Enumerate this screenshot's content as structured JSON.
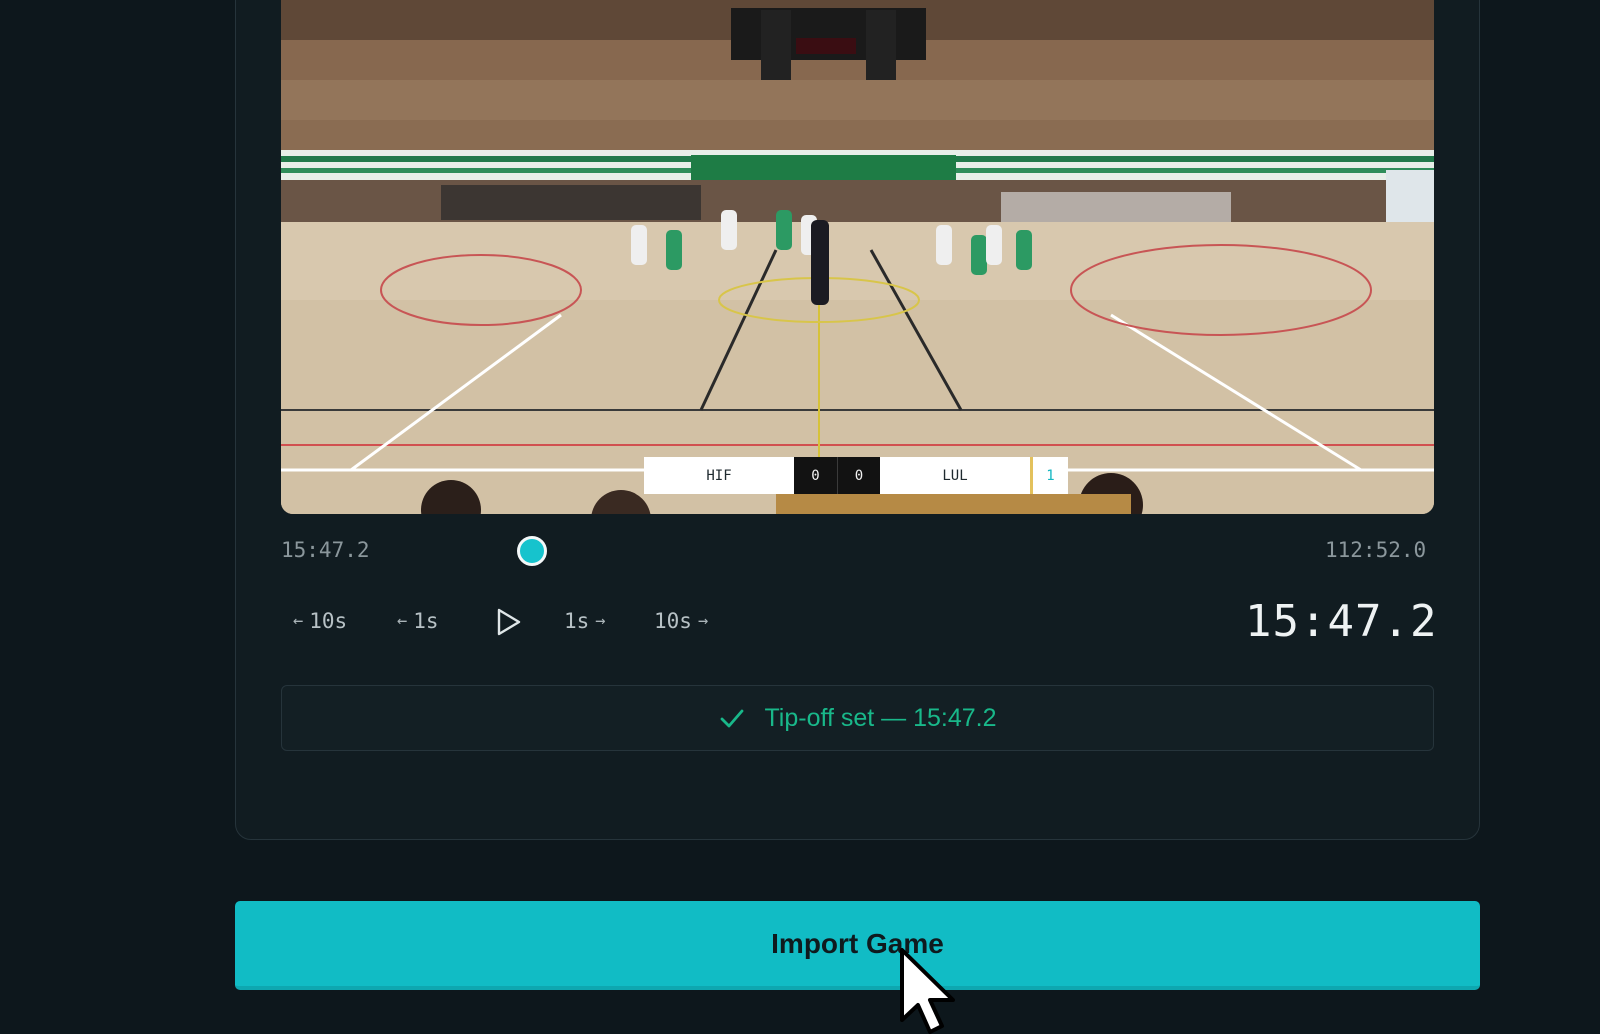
{
  "scoreboard_overlay": {
    "home_team": "HIF",
    "home_score": "0",
    "away_score": "0",
    "away_team": "LUL",
    "period": "1"
  },
  "timeline": {
    "current_time": "15:47.2",
    "end_time": "112:52.0",
    "progress": 0.14
  },
  "transport": {
    "back_10": "10s",
    "back_1": "1s",
    "fwd_1": "1s",
    "fwd_10": "10s"
  },
  "big_time": "15:47.2",
  "tipoff_status": "Tip-off set — 15:47.2",
  "import_button": "Import Game",
  "colors": {
    "accent": "#11bcc5",
    "success": "#19b88a",
    "background": "#0d171c"
  }
}
